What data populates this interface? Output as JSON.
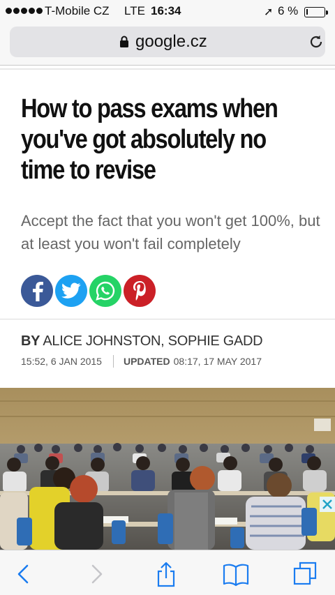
{
  "status_bar": {
    "carrier": "T-Mobile CZ",
    "network": "LTE",
    "time": "16:34",
    "battery_percent": "6 %",
    "battery_level": 0.06
  },
  "browser": {
    "url": "google.cz"
  },
  "article": {
    "headline": "How to pass exams when you've got absolutely no time to revise",
    "standfirst": "Accept the fact that you won't get 100%, but at least you won't fail completely",
    "share": [
      "facebook-icon",
      "twitter-icon",
      "whatsapp-icon",
      "pinterest-icon"
    ],
    "byline_prefix": "BY",
    "authors": "ALICE JOHNSTON, SOPHIE GADD",
    "published": "15:52, 6 JAN 2015",
    "updated_label": "UPDATED",
    "updated": "08:17, 17 MAY 2017"
  },
  "colors": {
    "facebook": "#3b5998",
    "twitter": "#1da1f2",
    "whatsapp": "#25d366",
    "pinterest": "#cb2027",
    "ios_blue": "#1a7cf0"
  },
  "toolbar": {
    "icons": [
      "back-icon",
      "forward-icon",
      "share-icon",
      "bookmarks-icon",
      "tabs-icon"
    ]
  }
}
